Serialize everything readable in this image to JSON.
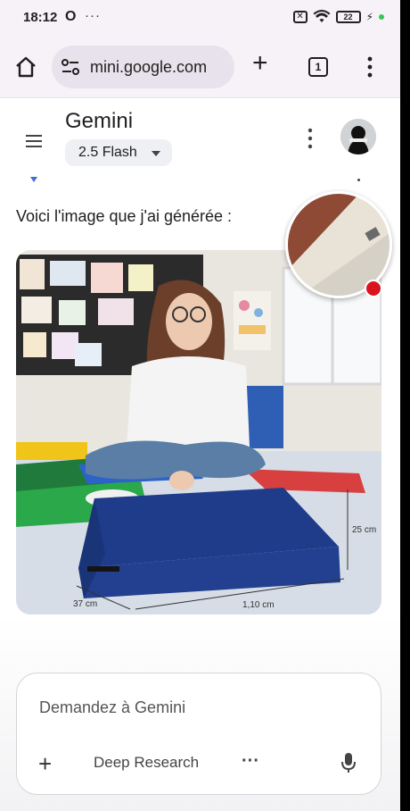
{
  "status": {
    "time": "18:12",
    "indicator": "O",
    "more": "···",
    "battery": "22"
  },
  "browser": {
    "url": "mini.google.com",
    "tab_count": "1"
  },
  "gemini": {
    "title": "Gemini",
    "model": "2.5 Flash"
  },
  "response": {
    "text": "Voici l'image que j'ai générée :"
  },
  "image": {
    "dim_width": "37 cm",
    "dim_length": "1,10 cm",
    "dim_height": "25 cm"
  },
  "composer": {
    "placeholder": "Demandez à Gemini",
    "deep_research": "Deep Research",
    "more": "···"
  },
  "icons": {
    "home": "home-icon",
    "site_settings": "tune-icon",
    "new_tab": "plus-icon",
    "tabs": "tab-switcher-icon",
    "menu": "more-vert-icon",
    "hamburger": "hamburger-menu-icon",
    "mic": "microphone-icon"
  },
  "colors": {
    "accent": "#3b6fd6",
    "record": "#d9141d",
    "toolbar_bg": "#f6f2f8"
  }
}
